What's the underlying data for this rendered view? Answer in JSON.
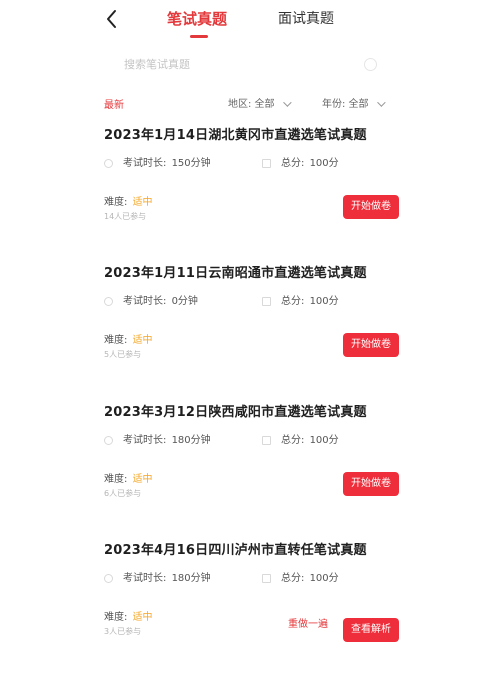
{
  "header": {
    "tabs": [
      {
        "label": "笔试真题",
        "active": true
      },
      {
        "label": "面试真题",
        "active": false
      }
    ]
  },
  "search": {
    "placeholder": "搜索笔试真题"
  },
  "filters": {
    "latest_label": "最新",
    "region_label": "地区: 全部",
    "year_label": "年份: 全部"
  },
  "cards": [
    {
      "title": "2023年1月14日湖北黄冈市直遴选笔试真题",
      "duration_label": "考试时长:",
      "duration_value": "150分钟",
      "score_label": "总分:",
      "score_value": "100分",
      "difficulty_label": "难度:",
      "difficulty_value": "适中",
      "participants": "14人已参与",
      "button_label": "开始做卷"
    },
    {
      "title": "2023年1月11日云南昭通市直遴选笔试真题",
      "duration_label": "考试时长:",
      "duration_value": "0分钟",
      "score_label": "总分:",
      "score_value": "100分",
      "difficulty_label": "难度:",
      "difficulty_value": "适中",
      "participants": "5人已参与",
      "button_label": "开始做卷"
    },
    {
      "title": "2023年3月12日陕西咸阳市直遴选笔试真题",
      "duration_label": "考试时长:",
      "duration_value": "180分钟",
      "score_label": "总分:",
      "score_value": "100分",
      "difficulty_label": "难度:",
      "difficulty_value": "适中",
      "participants": "6人已参与",
      "button_label": "开始做卷"
    },
    {
      "title": "2023年4月16日四川泸州市直转任笔试真题",
      "duration_label": "考试时长:",
      "duration_value": "180分钟",
      "score_label": "总分:",
      "score_value": "100分",
      "difficulty_label": "难度:",
      "difficulty_value": "适中",
      "participants": "3人已参与",
      "redo_label": "重做一遍",
      "button_label": "查看解析"
    }
  ],
  "colors": {
    "accent": "#e4393c",
    "button": "#ee2e3a",
    "difficulty": "#f5a623"
  }
}
